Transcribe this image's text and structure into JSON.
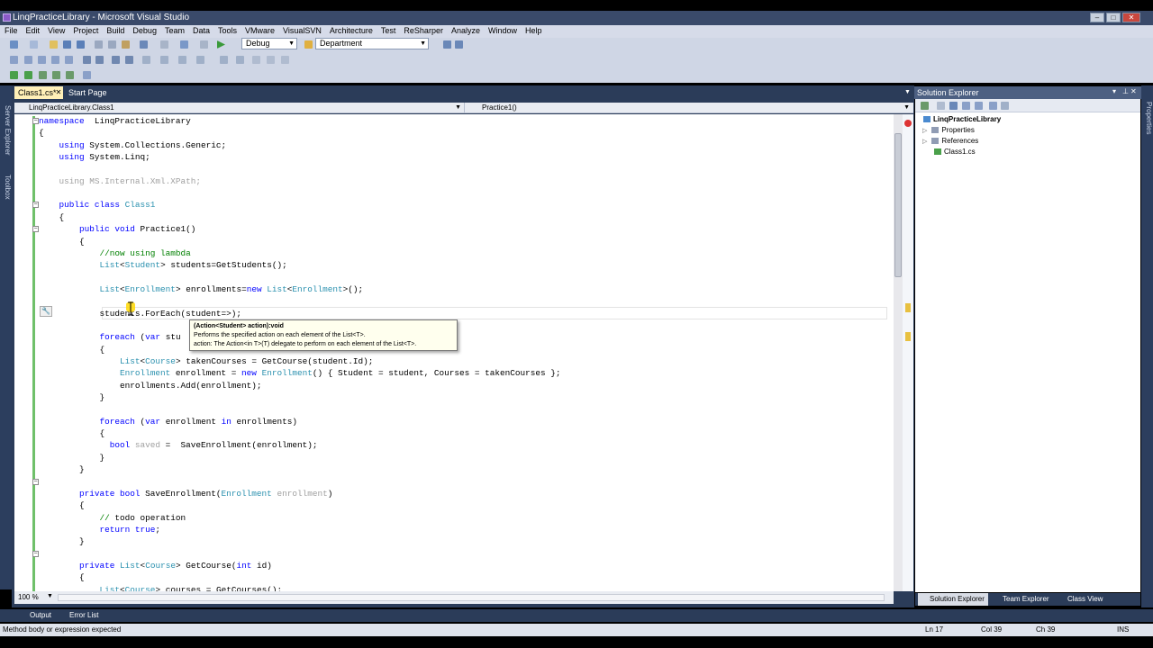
{
  "window": {
    "title": "LinqPracticeLibrary - Microsoft Visual Studio"
  },
  "menu": [
    "File",
    "Edit",
    "View",
    "Project",
    "Build",
    "Debug",
    "Team",
    "Data",
    "Tools",
    "VMware",
    "VisualSVN",
    "Architecture",
    "Test",
    "ReSharper",
    "Analyze",
    "Window",
    "Help"
  ],
  "toolbar": {
    "config": "Debug",
    "find": "Department"
  },
  "left_tabs": [
    "Server Explorer",
    "Toolbox"
  ],
  "doc_tabs": [
    {
      "label": "Class1.cs*"
    },
    {
      "label": "Start Page"
    }
  ],
  "navbar": {
    "type": "LinqPracticeLibrary.Class1",
    "member": "Practice1()"
  },
  "code_lines": [
    {
      "parts": [
        [
          "kw",
          "namespace"
        ],
        [
          "",
          "  LinqPracticeLibrary"
        ]
      ]
    },
    {
      "parts": [
        [
          "",
          "{"
        ]
      ]
    },
    {
      "parts": [
        [
          "",
          "    "
        ],
        [
          "kw",
          "using"
        ],
        [
          "",
          " System.Collections.Generic;"
        ]
      ]
    },
    {
      "parts": [
        [
          "",
          "    "
        ],
        [
          "kw",
          "using"
        ],
        [
          "",
          " System.Linq;"
        ]
      ]
    },
    {
      "parts": [
        [
          "",
          ""
        ]
      ]
    },
    {
      "parts": [
        [
          "gr",
          "    using MS.Internal.Xml.XPath;"
        ]
      ]
    },
    {
      "parts": [
        [
          "",
          ""
        ]
      ]
    },
    {
      "parts": [
        [
          "",
          "    "
        ],
        [
          "kw",
          "public class"
        ],
        [
          "tp",
          " Class1"
        ]
      ]
    },
    {
      "parts": [
        [
          "",
          "    {"
        ]
      ]
    },
    {
      "parts": [
        [
          "",
          "        "
        ],
        [
          "kw",
          "public void"
        ],
        [
          "",
          " Practice1()"
        ]
      ]
    },
    {
      "parts": [
        [
          "",
          "        {"
        ]
      ]
    },
    {
      "parts": [
        [
          "cm",
          "            //now using lambda"
        ]
      ]
    },
    {
      "parts": [
        [
          "",
          "            "
        ],
        [
          "tp",
          "List"
        ],
        [
          "",
          "<"
        ],
        [
          "tp",
          "Student"
        ],
        [
          "",
          "> students=GetStudents();"
        ]
      ]
    },
    {
      "parts": [
        [
          "",
          ""
        ]
      ]
    },
    {
      "parts": [
        [
          "",
          "            "
        ],
        [
          "tp",
          "List"
        ],
        [
          "",
          "<"
        ],
        [
          "tp",
          "Enrollment"
        ],
        [
          "",
          "> enrollments="
        ],
        [
          "kw",
          "new"
        ],
        [
          "tp",
          " List"
        ],
        [
          "",
          "<"
        ],
        [
          "tp",
          "Enrollment"
        ],
        [
          "",
          ">();"
        ]
      ]
    },
    {
      "parts": [
        [
          "",
          ""
        ]
      ]
    },
    {
      "parts": [
        [
          "",
          "            students.ForEach(student=>);"
        ]
      ]
    },
    {
      "parts": [
        [
          "",
          ""
        ]
      ]
    },
    {
      "parts": [
        [
          "",
          "            "
        ],
        [
          "kw",
          "foreach"
        ],
        [
          "",
          " ("
        ],
        [
          "kw",
          "var"
        ],
        [
          "",
          " stu"
        ]
      ]
    },
    {
      "parts": [
        [
          "",
          "            {"
        ]
      ]
    },
    {
      "parts": [
        [
          "",
          "                "
        ],
        [
          "tp",
          "List"
        ],
        [
          "",
          "<"
        ],
        [
          "tp",
          "Course"
        ],
        [
          "",
          "> takenCourses = GetCourse(student.Id);"
        ]
      ]
    },
    {
      "parts": [
        [
          "",
          "                "
        ],
        [
          "tp",
          "Enrollment"
        ],
        [
          "",
          " enrollment = "
        ],
        [
          "kw",
          "new"
        ],
        [
          "tp",
          " Enrollment"
        ],
        [
          "",
          "() { Student = student, Courses = takenCourses };"
        ]
      ]
    },
    {
      "parts": [
        [
          "",
          "                enrollments.Add(enrollment);"
        ]
      ]
    },
    {
      "parts": [
        [
          "",
          "            }"
        ]
      ]
    },
    {
      "parts": [
        [
          "",
          ""
        ]
      ]
    },
    {
      "parts": [
        [
          "",
          "            "
        ],
        [
          "kw",
          "foreach"
        ],
        [
          "",
          " ("
        ],
        [
          "kw",
          "var"
        ],
        [
          "",
          " enrollment "
        ],
        [
          "kw",
          "in"
        ],
        [
          "",
          " enrollments)"
        ]
      ]
    },
    {
      "parts": [
        [
          "",
          "            {"
        ]
      ]
    },
    {
      "parts": [
        [
          "",
          "              "
        ],
        [
          "kw",
          "bool"
        ],
        [
          "gr",
          " saved"
        ],
        [
          "",
          " =  SaveEnrollment(enrollment);"
        ]
      ]
    },
    {
      "parts": [
        [
          "",
          "            }"
        ]
      ]
    },
    {
      "parts": [
        [
          "",
          "        }"
        ]
      ]
    },
    {
      "parts": [
        [
          "",
          ""
        ]
      ]
    },
    {
      "parts": [
        [
          "",
          "        "
        ],
        [
          "kw",
          "private bool"
        ],
        [
          "",
          " SaveEnrollment("
        ],
        [
          "tp",
          "Enrollment"
        ],
        [
          "gr",
          " enrollment"
        ],
        [
          "",
          ")"
        ]
      ]
    },
    {
      "parts": [
        [
          "",
          "        {"
        ]
      ]
    },
    {
      "parts": [
        [
          "cm",
          "            // "
        ],
        [
          "",
          "todo operation"
        ]
      ]
    },
    {
      "parts": [
        [
          "",
          "            "
        ],
        [
          "kw",
          "return true"
        ],
        [
          "",
          ";"
        ]
      ]
    },
    {
      "parts": [
        [
          "",
          "        }"
        ]
      ]
    },
    {
      "parts": [
        [
          "",
          ""
        ]
      ]
    },
    {
      "parts": [
        [
          "",
          "        "
        ],
        [
          "kw",
          "private"
        ],
        [
          "tp",
          " List"
        ],
        [
          "",
          "<"
        ],
        [
          "tp",
          "Course"
        ],
        [
          "",
          "> GetCourse("
        ],
        [
          "kw",
          "int"
        ],
        [
          "",
          " id)"
        ]
      ]
    },
    {
      "parts": [
        [
          "",
          "        {"
        ]
      ]
    },
    {
      "parts": [
        [
          "",
          "            "
        ],
        [
          "tp",
          "List"
        ],
        [
          "",
          "<"
        ],
        [
          "tp",
          "Course"
        ],
        [
          "",
          "> courses = GetCourses();"
        ]
      ]
    }
  ],
  "tooltip": {
    "line1": "(Action<Student> action):void",
    "line2": "Performs the specified action on each element of the List<T>.",
    "line3": "action: The Action<in T>(T) delegate to perform on each element of the List<T>."
  },
  "zoom": "100 %",
  "solution_explorer": {
    "title": "Solution Explorer",
    "items": [
      "LinqPracticeLibrary",
      "Properties",
      "References",
      "Class1.cs"
    ]
  },
  "right_tabs": [
    "Properties"
  ],
  "se_tabs": [
    "Solution Explorer",
    "Team Explorer",
    "Class View"
  ],
  "bottom_tabs": [
    "Output",
    "Error List"
  ],
  "status": {
    "message": "Method body or expression expected",
    "ln": "Ln 17",
    "col": "Col 39",
    "ch": "Ch 39",
    "mode": "INS"
  }
}
